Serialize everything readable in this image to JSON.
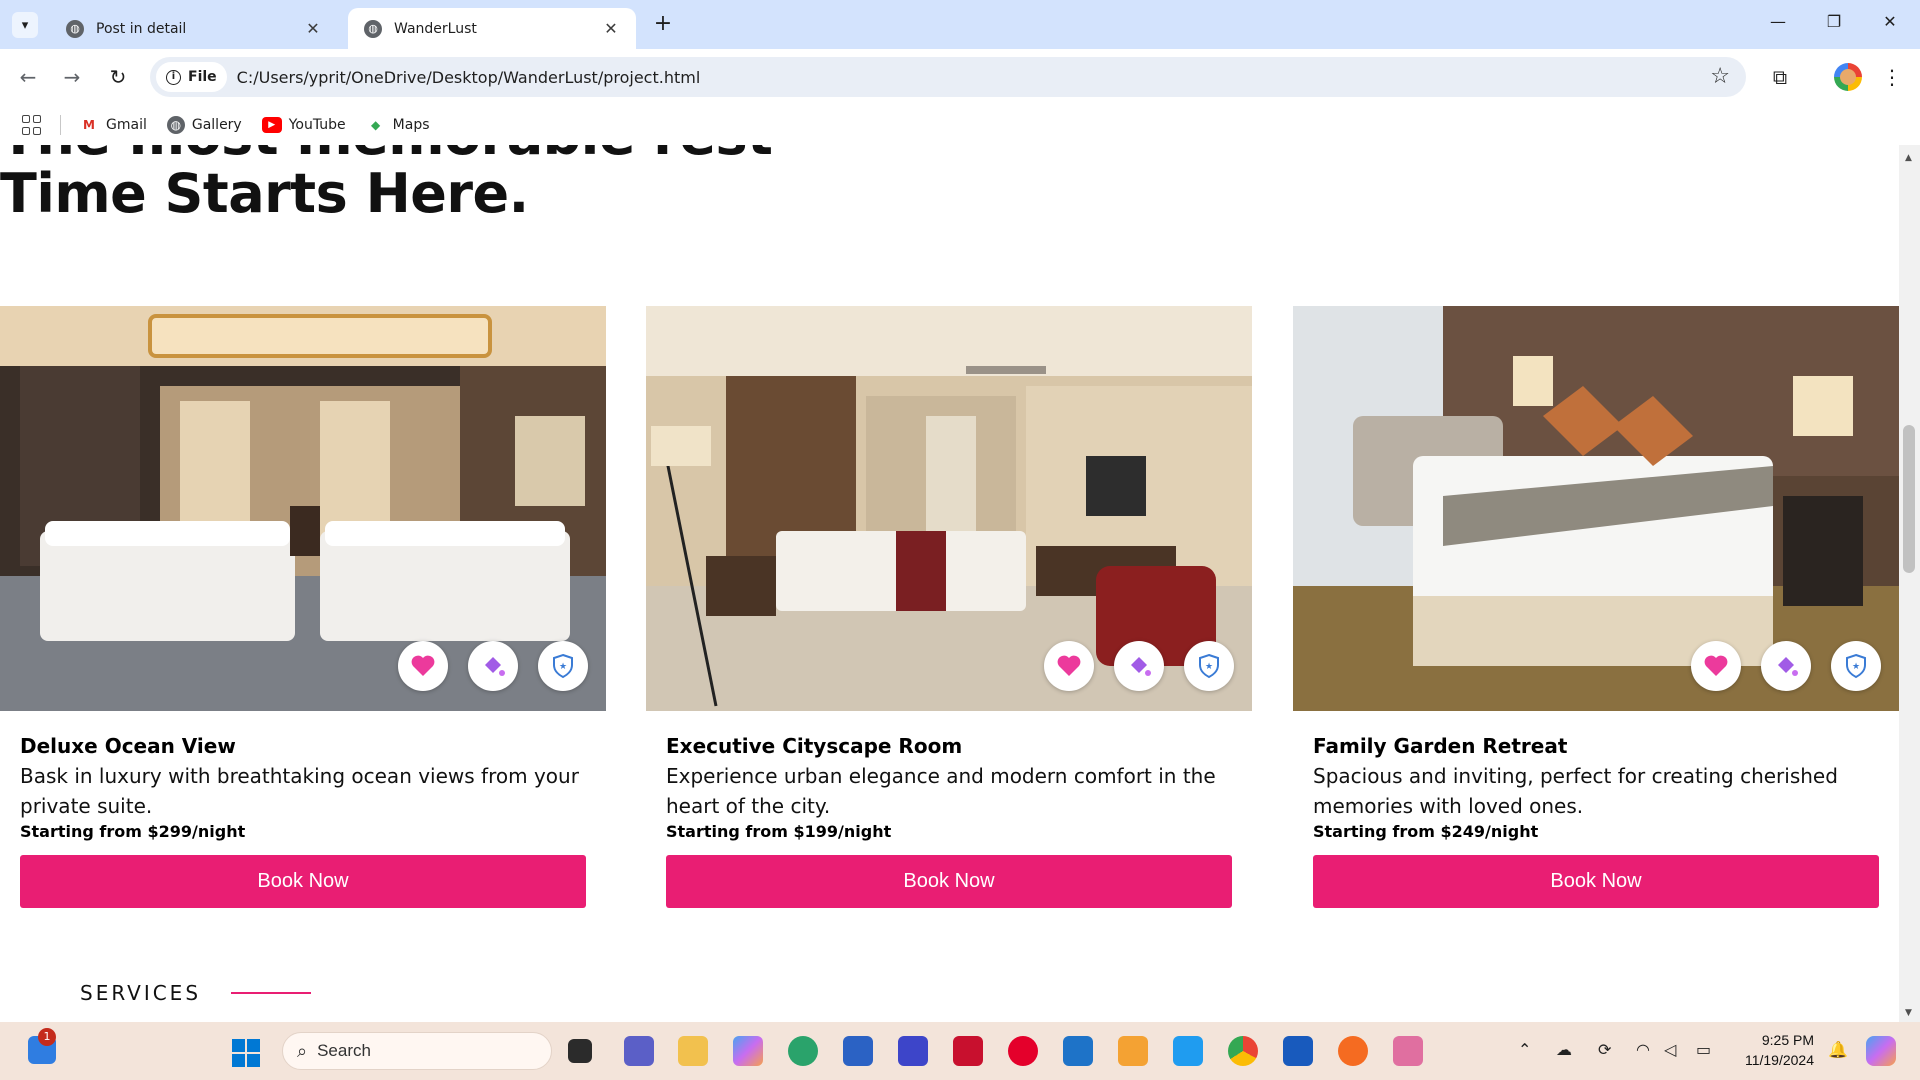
{
  "browser": {
    "tabs": [
      {
        "title": "Post in detail",
        "active": false
      },
      {
        "title": "WanderLust",
        "active": true
      }
    ],
    "omnibox": {
      "chip_label": "File",
      "url": "C:/Users/yprit/OneDrive/Desktop/WanderLust/project.html"
    },
    "bookmarks": [
      {
        "label": "Gmail",
        "icon": "gmail-icon"
      },
      {
        "label": "Gallery",
        "icon": "gallery-icon"
      },
      {
        "label": "YouTube",
        "icon": "youtube-icon"
      },
      {
        "label": "Maps",
        "icon": "maps-icon"
      }
    ]
  },
  "page": {
    "heading_partial": "The most memorable rest",
    "heading_main": "Time Starts Here.",
    "rooms": [
      {
        "title": "Deluxe Ocean View",
        "description": "Bask in luxury with breathtaking ocean views from your private suite.",
        "price": "Starting from $299/night",
        "button": "Book Now"
      },
      {
        "title": "Executive Cityscape Room",
        "description": "Experience urban elegance and modern comfort in the heart of the city.",
        "price": "Starting from $199/night",
        "button": "Book Now"
      },
      {
        "title": "Family Garden Retreat",
        "description": "Spacious and inviting, perfect for creating cherished memories with loved ones.",
        "price": "Starting from $249/night",
        "button": "Book Now"
      }
    ],
    "services_label": "SERVICES"
  },
  "taskbar": {
    "search_placeholder": "Search",
    "notification_count": "1",
    "time": "9:25 PM",
    "date": "11/19/2024"
  },
  "colors": {
    "accent": "#e91e73",
    "tabstrip": "#d3e3fd",
    "taskbar": "#f3e4da"
  }
}
